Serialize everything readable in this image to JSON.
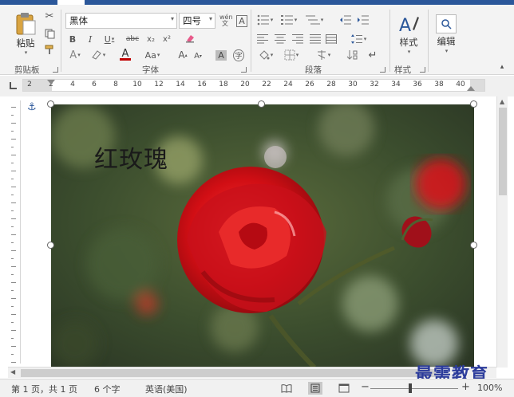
{
  "ribbon": {
    "clipboard": {
      "paste_label": "粘贴",
      "group_label": "剪贴板"
    },
    "font": {
      "family": "黑体",
      "size": "四号",
      "group_label": "字体",
      "bold": "B",
      "italic": "I",
      "underline": "U",
      "strike": "abc",
      "subscript": "x₂",
      "superscript": "x²",
      "grow": "A",
      "shrink": "A",
      "case": "Aa",
      "clear": "A",
      "wen": "wén 文",
      "char_border": "A",
      "char_shade": "A",
      "char_circle": "字"
    },
    "paragraph": {
      "group_label": "段落"
    },
    "styles": {
      "button_label": "样式",
      "group_label": "样式"
    },
    "editing": {
      "button_label": "编辑"
    }
  },
  "ruler": {
    "ticks": [
      "2",
      "2",
      "4",
      "6",
      "8",
      "10",
      "12",
      "14",
      "16",
      "18",
      "20",
      "22",
      "24",
      "26",
      "28",
      "30",
      "32",
      "34",
      "36",
      "38",
      "40"
    ]
  },
  "document": {
    "photo_caption": "红玫瑰"
  },
  "status": {
    "page": "第 1 页，共 1 页",
    "words": "6 个字",
    "language": "英语(美国)",
    "zoom_minus": "−",
    "zoom_plus": "+",
    "zoom": "100%"
  },
  "watermark": "最需教育",
  "colors": {
    "accent": "#2b579a",
    "font_color": "#c00000"
  }
}
